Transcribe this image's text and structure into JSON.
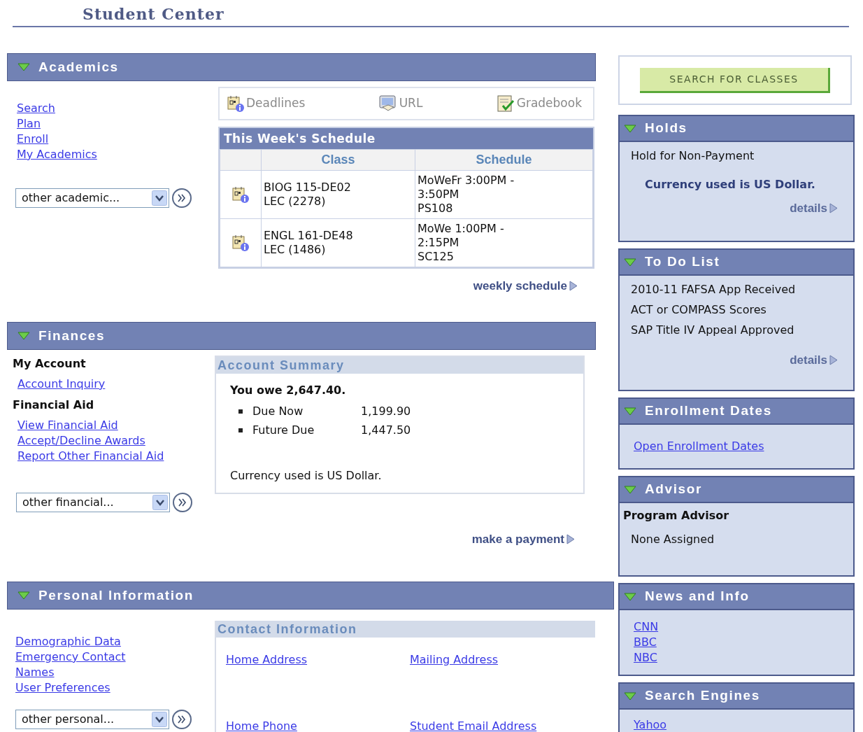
{
  "page_title": "Student Center",
  "academics": {
    "title": "Academics",
    "expanded": true,
    "links": [
      "Search",
      "Plan",
      "Enroll",
      "My Academics"
    ],
    "other_select": "other academic...",
    "toolbar": [
      {
        "kind": "deadlines",
        "label": "Deadlines"
      },
      {
        "kind": "url",
        "label": "URL"
      },
      {
        "kind": "gradebook",
        "label": "Gradebook"
      }
    ],
    "schedule": {
      "title": "This Week's Schedule",
      "columns": [
        "Class",
        "Schedule"
      ],
      "rows": [
        {
          "class": [
            "BIOG 115-DE02",
            "LEC (2278)"
          ],
          "schedule": [
            "MoWeFr 3:00PM -",
            "3:50PM",
            "PS108"
          ]
        },
        {
          "class": [
            "ENGL 161-DE48",
            "LEC (1486)"
          ],
          "schedule": [
            "MoWe 1:00PM -",
            "2:15PM",
            "SC125"
          ]
        }
      ]
    },
    "more_link": "weekly schedule"
  },
  "finances": {
    "title": "Finances",
    "expanded": true,
    "groups": [
      {
        "heading": "My Account",
        "links": [
          "Account Inquiry"
        ]
      },
      {
        "heading": "Financial Aid",
        "links": [
          "View Financial Aid",
          "Accept/Decline Awards",
          "Report Other Financial Aid"
        ]
      }
    ],
    "other_select": "other financial...",
    "summary": {
      "title": "Account Summary",
      "owe": "You owe 2,647.40.",
      "lines": [
        {
          "label": "Due Now",
          "amount": "1,199.90"
        },
        {
          "label": "Future Due",
          "amount": "1,447.50"
        }
      ],
      "currency": "Currency used is US Dollar."
    },
    "more_link": "make a payment"
  },
  "personal": {
    "title": "Personal Information",
    "expanded": true,
    "links": [
      "Demographic Data",
      "Emergency Contact",
      "Names",
      "User Preferences"
    ],
    "other_select": "other personal...",
    "contact": {
      "title": "Contact Information",
      "links": [
        "Home Address",
        "Mailing Address",
        "Home Phone",
        "Student Email Address"
      ]
    }
  },
  "search_button": "SEARCH FOR CLASSES",
  "panels": [
    {
      "title": "Holds",
      "expanded": true,
      "items": [
        {
          "kind": "text",
          "text": "Hold for Non-Payment"
        },
        {
          "kind": "note",
          "text": "Currency used is US Dollar."
        }
      ],
      "details": "details"
    },
    {
      "title": "To Do List",
      "expanded": true,
      "items": [
        {
          "kind": "text",
          "text": "2010-11 FAFSA App Received"
        },
        {
          "kind": "text",
          "text": "ACT or COMPASS Scores"
        },
        {
          "kind": "text",
          "text": "SAP Title IV Appeal Approved"
        }
      ],
      "details": "details"
    },
    {
      "title": "Enrollment Dates",
      "expanded": true,
      "items": [
        {
          "kind": "link",
          "text": "Open Enrollment Dates"
        }
      ]
    },
    {
      "title": "Advisor",
      "expanded": true,
      "items": [
        {
          "kind": "heading",
          "text": "Program Advisor"
        },
        {
          "kind": "text",
          "text": "None Assigned"
        }
      ]
    },
    {
      "title": "News and Info",
      "expanded": true,
      "items": [
        {
          "kind": "link",
          "text": "CNN"
        },
        {
          "kind": "link",
          "text": "BBC"
        },
        {
          "kind": "link",
          "text": "NBC"
        }
      ]
    },
    {
      "title": "Search Engines",
      "expanded": true,
      "items": [
        {
          "kind": "link",
          "text": "Yahoo"
        }
      ]
    }
  ]
}
